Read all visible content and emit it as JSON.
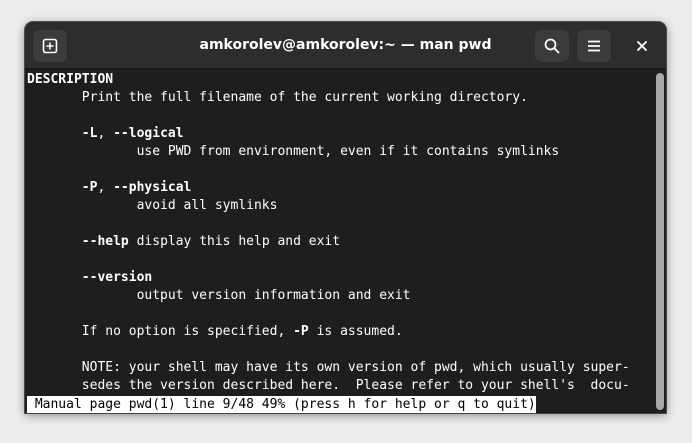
{
  "window": {
    "title": "amkorolev@amkorolev:~ — man pwd"
  },
  "icons": {
    "new_tab": "new-tab-icon",
    "search": "search-icon",
    "menu": "hamburger-menu-icon",
    "close": "close-icon"
  },
  "man": {
    "section_heading": "DESCRIPTION",
    "intro": "       Print the full filename of the current working directory.",
    "opt_L_flag": "-L",
    "opt_L_sep": ", ",
    "opt_L_long": "--logical",
    "opt_L_desc": "              use PWD from environment, even if it contains symlinks",
    "opt_P_flag": "-P",
    "opt_P_sep": ", ",
    "opt_P_long": "--physical",
    "opt_P_desc": "              avoid all symlinks",
    "help_flag": "--help",
    "help_desc": " display this help and exit",
    "version_flag": "--version",
    "version_desc": "              output version information and exit",
    "default_text_1": "       If no option is specified, ",
    "default_flag": "-P",
    "default_text_2": " is assumed.",
    "note_line_1": "       NOTE: your shell may have its own version of pwd, which usually super-",
    "note_line_2": "       sedes the version described here.  Please refer to your shell's  docu-"
  },
  "status_line": " Manual page pwd(1) line 9/48 49% (press h for help or q to quit)",
  "colors": {
    "terminal_bg": "#1e1e1e",
    "headerbar_bg": "#2d2d2d",
    "text": "#ffffff",
    "status_bg": "#ffffff",
    "status_fg": "#000000"
  }
}
